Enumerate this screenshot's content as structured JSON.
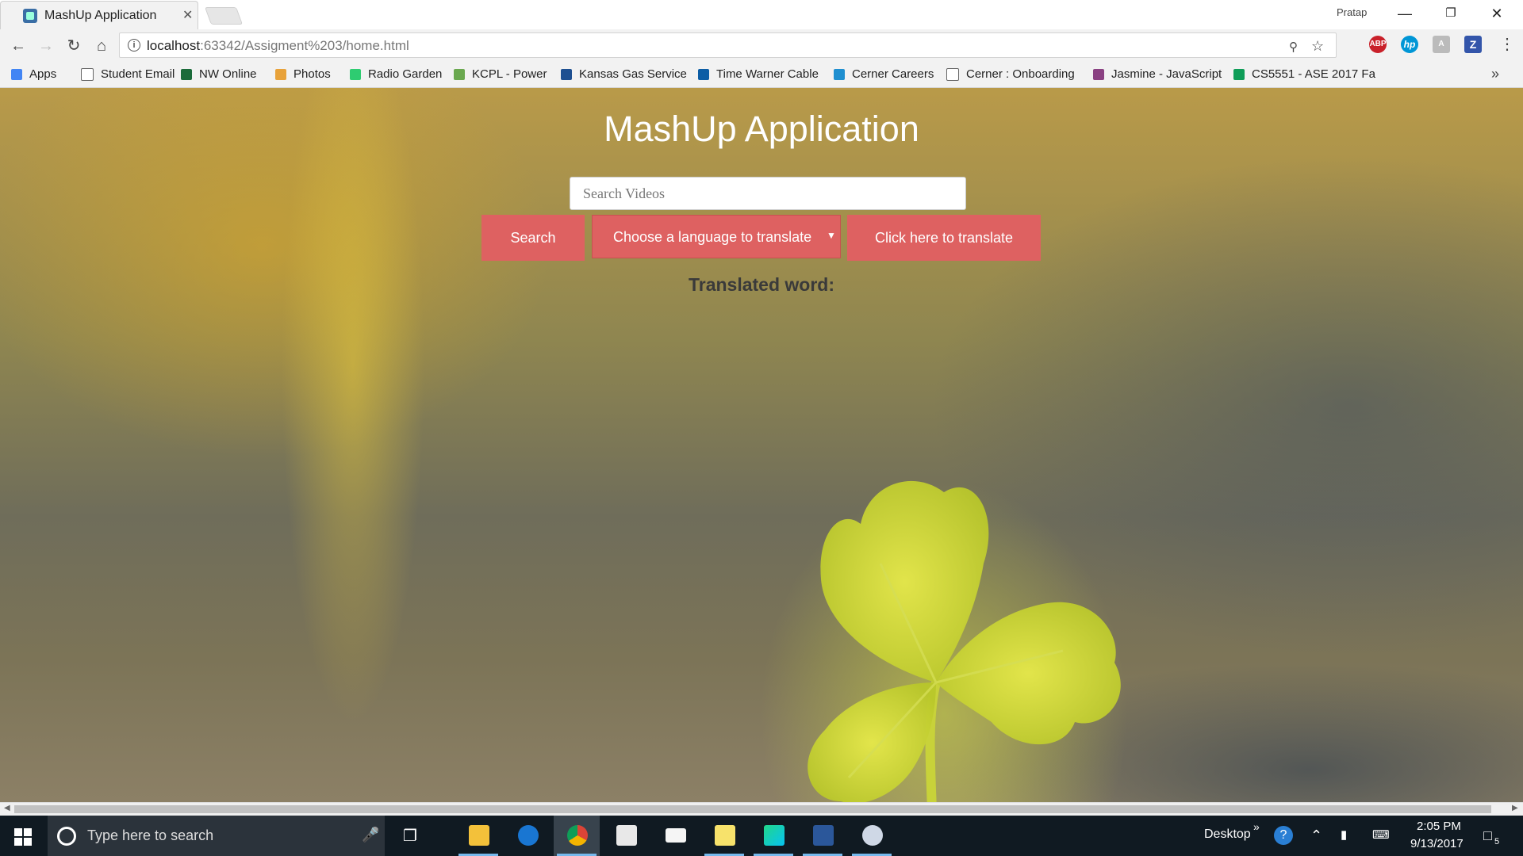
{
  "browser": {
    "tab_title": "MashUp Application",
    "profile_name": "Pratap",
    "url_host": "localhost",
    "url_rest": ":63342/Assigment%203/home.html"
  },
  "bookmarks": [
    {
      "label": "Apps",
      "icon": "apps-grid-icon",
      "color": "#4285f4"
    },
    {
      "label": "Student Email",
      "icon": "page-icon",
      "color": "#ffffff"
    },
    {
      "label": "NW Online",
      "icon": "nw-logo-icon",
      "color": "#1b6b3a"
    },
    {
      "label": "Photos",
      "icon": "photos-pinwheel-icon",
      "color": "#e8a23a"
    },
    {
      "label": "Radio Garden",
      "icon": "green-dot-icon",
      "color": "#2ecc71"
    },
    {
      "label": "KCPL - Power",
      "icon": "kcpl-leaf-icon",
      "color": "#6aa84f"
    },
    {
      "label": "Kansas Gas Service",
      "icon": "kgs-g-icon",
      "color": "#1d4f91"
    },
    {
      "label": "Time Warner Cable",
      "icon": "twc-play-icon",
      "color": "#0c5da5"
    },
    {
      "label": "Cerner Careers",
      "icon": "cerner-sun-icon",
      "color": "#1f8fd0"
    },
    {
      "label": "Cerner : Onboarding",
      "icon": "page-icon",
      "color": "#ffffff"
    },
    {
      "label": "Jasmine - JavaScript",
      "icon": "jasmine-icon",
      "color": "#8a4182"
    },
    {
      "label": "CS5551 - ASE 2017 Fa",
      "icon": "sheets-icon",
      "color": "#0f9d58"
    }
  ],
  "page": {
    "title": "MashUp Application",
    "search_placeholder": "Search Videos",
    "search_button": "Search",
    "language_select": "Choose a language to translate",
    "translate_button": "Click here to translate",
    "translated_label": "Translated word:"
  },
  "taskbar": {
    "search_placeholder": "Type here to search",
    "desktop_label": "Desktop",
    "time": "2:05 PM",
    "date": "9/13/2017",
    "notification_count": "5",
    "apps": [
      "file-explorer-icon",
      "edge-icon",
      "chrome-icon",
      "store-icon",
      "mail-icon",
      "sticky-notes-icon",
      "webstorm-icon",
      "word-icon",
      "paint-icon"
    ]
  },
  "colors": {
    "button_bg": "#de6161",
    "title_text": "#ffffff",
    "taskbar_bg": "#101a22"
  }
}
